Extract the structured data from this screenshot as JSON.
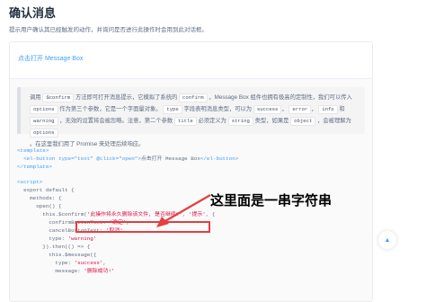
{
  "page": {
    "title": "确认消息",
    "description": "提示用户确认其已经触发的动作，并询问是否进行此操作时会用到此对话框。"
  },
  "demo": {
    "open_link": "点击打开 Message Box"
  },
  "tip": {
    "line1_a": "调用",
    "c_confirm": "$confirm",
    "line1_b": "方法即可打开消息提示，它模拟了系统的",
    "c_confirm2": "confirm",
    "line1_c": "，Message Box 组件也拥有极高的定制性，我们可以传入",
    "c_options": "options",
    "line2_a": "作为第三个参数，它是一个字面量对象。",
    "c_type": "type",
    "line2_b": "字段表明消息类型，可以为",
    "c_success": "success",
    "line2_c": "，",
    "c_error": "error",
    "line2_d": "，",
    "c_info": "info",
    "line2_e": "和",
    "c_warning": "warning",
    "line3_a": "，无效的设置将会被忽略。注意，第二个参数",
    "c_title": "title",
    "line3_b": "必须定义为",
    "c_string": "string",
    "line3_c": "类型，如果是",
    "c_object": "object",
    "line3_d": "，会被理解为",
    "c_options2": "options",
    "line3_e": "。在这里我们用了 Promise 来处理后续响应。"
  },
  "code": {
    "l1": "<template>",
    "l2a": "  <el-button type=\"text\" @click=\"open\">",
    "l2b": "点击打开 Message Box",
    "l2c": "</el-button>",
    "l3": "</template>",
    "l5": "<script>",
    "l6": "  export default {",
    "l7": "    methods: {",
    "l8": "      open() {",
    "l9a": "        this.$confirm(",
    "l9b": "'此操作将永久删除该文件, 是否继续?'",
    "l9c": ", ",
    "l9d": "'提示'",
    "l9e": ", {",
    "l10a": "          confirmButtonText: ",
    "l10b": "'确定'",
    "l10c": ",",
    "l11a": "          cancelButtonText: ",
    "l11b": "'取消'",
    "l11c": ",",
    "l12a": "          type: ",
    "l12b": "'warning'",
    "l13": "        }).then(() => {",
    "l14": "          this.$message({",
    "l15a": "            type: ",
    "l15b": "'success'",
    "l15c": ",",
    "l16a": "            message: ",
    "l16b": "'删除成功!'"
  },
  "annotation": {
    "text": "这里面是一串字符串",
    "color": "#e53e3e"
  },
  "back_top": {
    "icon": "caret-up-icon",
    "glyph": "▲"
  },
  "colors": {
    "link": "#409eff",
    "string": "#dd1144",
    "tag": "#409eff"
  }
}
